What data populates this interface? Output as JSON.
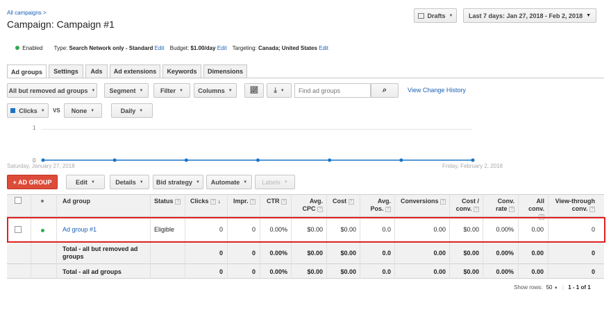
{
  "breadcrumb": "All campaigns >",
  "title_prefix": "Campaign:",
  "title": "Campaign #1",
  "drafts_label": "Drafts",
  "date_range": "Last 7 days: Jan 27, 2018 - Feb 2, 2018",
  "info": {
    "status": "Enabled",
    "type_label": "Type:",
    "type_value": "Search Network only - Standard",
    "edit": "Edit",
    "budget_label": "Budget:",
    "budget_value": "$1.00/day",
    "targeting_label": "Targeting:",
    "targeting_value": "Canada; United States"
  },
  "tabs": [
    "Ad groups",
    "Settings",
    "Ads",
    "Ad extensions",
    "Keywords",
    "Dimensions"
  ],
  "toolbar": {
    "filter_scope": "All but removed ad groups",
    "segment": "Segment",
    "filter": "Filter",
    "columns": "Columns",
    "search_placeholder": "Find ad groups",
    "view_history": "View Change History"
  },
  "chart_controls": {
    "metric1": "Clicks",
    "vs": "VS",
    "metric2": "None",
    "period": "Daily"
  },
  "chart_data": {
    "type": "line",
    "x": [
      "Saturday, January 27, 2018",
      "",
      "",
      "",
      "",
      "",
      "Friday, February 2, 2018"
    ],
    "series": [
      {
        "name": "Clicks",
        "values": [
          0,
          0,
          0,
          0,
          0,
          0,
          0
        ]
      }
    ],
    "ylim": [
      0,
      1
    ],
    "yticks": [
      "1",
      "0"
    ],
    "x_start_label": "Saturday, January 27, 2018",
    "x_end_label": "Friday, February 2, 2018",
    "color": "#1a73c7"
  },
  "actions": {
    "add": "+ AD GROUP",
    "edit": "Edit",
    "details": "Details",
    "bid_strategy": "Bid strategy",
    "automate": "Automate",
    "labels": "Labels"
  },
  "table": {
    "headers": {
      "ad_group": "Ad group",
      "status": "Status",
      "clicks": "Clicks",
      "impr": "Impr.",
      "ctr": "CTR",
      "avg_cpc_1": "Avg.",
      "avg_cpc_2": "CPC",
      "cost": "Cost",
      "avg_pos_1": "Avg.",
      "avg_pos_2": "Pos.",
      "conversions": "Conversions",
      "cost_conv_1": "Cost /",
      "cost_conv_2": "conv.",
      "conv_rate_1": "Conv.",
      "conv_rate_2": "rate",
      "all_conv_1": "All",
      "all_conv_2": "conv.",
      "vt_conv_1": "View-through",
      "vt_conv_2": "conv."
    },
    "row": {
      "name": "Ad group #1",
      "status": "Eligible",
      "clicks": "0",
      "impr": "0",
      "ctr": "0.00%",
      "avg_cpc": "$0.00",
      "cost": "$0.00",
      "avg_pos": "0.0",
      "conversions": "0.00",
      "cost_conv": "$0.00",
      "conv_rate": "0.00%",
      "all_conv": "0.00",
      "vt_conv": "0"
    },
    "total_removed": {
      "label_1": "Total - all but removed ad",
      "label_2": "groups",
      "clicks": "0",
      "impr": "0",
      "ctr": "0.00%",
      "avg_cpc": "$0.00",
      "cost": "$0.00",
      "avg_pos": "0.0",
      "conversions": "0.00",
      "cost_conv": "$0.00",
      "conv_rate": "0.00%",
      "all_conv": "0.00",
      "vt_conv": "0"
    },
    "total_all": {
      "label": "Total - all ad groups",
      "clicks": "0",
      "impr": "0",
      "ctr": "0.00%",
      "avg_cpc": "$0.00",
      "cost": "$0.00",
      "avg_pos": "0.0",
      "conversions": "0.00",
      "cost_conv": "$0.00",
      "conv_rate": "0.00%",
      "all_conv": "0.00",
      "vt_conv": "0"
    }
  },
  "pagination": {
    "show_rows_label": "Show rows:",
    "rows": "50",
    "range": "1 - 1 of 1"
  },
  "colors": {
    "accent": "#1a5fb4",
    "add_button": "#dd4b39",
    "enabled": "#34a853",
    "highlight": "#e02020"
  }
}
